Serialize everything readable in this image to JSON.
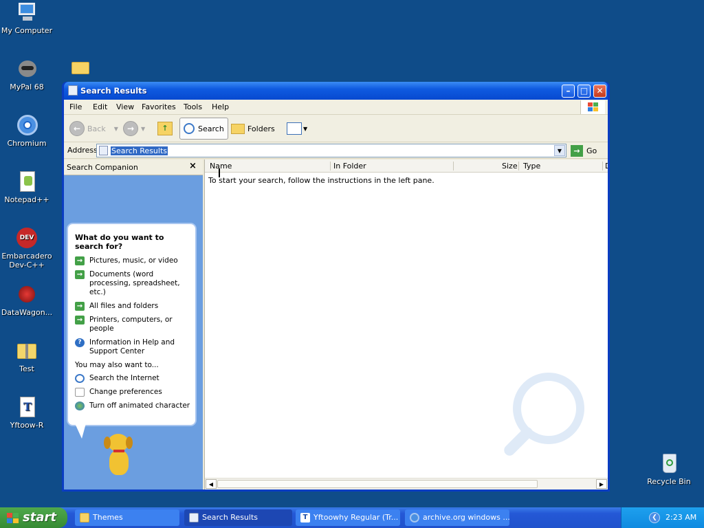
{
  "desktop": {
    "icons": [
      {
        "label": "My Computer"
      },
      {
        "label": "MyPal 68"
      },
      {
        "label": "Chromium"
      },
      {
        "label": "Notepad++"
      },
      {
        "label": "Embarcadero Dev-C++"
      },
      {
        "label": "DataWagon..."
      },
      {
        "label": "Test"
      },
      {
        "label": "Yftoow-R"
      },
      {
        "label": "Recycle Bin"
      }
    ]
  },
  "window": {
    "title": "Search Results",
    "menu": [
      "File",
      "Edit",
      "View",
      "Favorites",
      "Tools",
      "Help"
    ],
    "toolbar": {
      "back_label": "Back",
      "search_label": "Search",
      "folders_label": "Folders"
    },
    "address": {
      "label": "Address",
      "value": "Search Results",
      "go_label": "Go"
    },
    "companion": {
      "title": "Search Companion",
      "question": "What do you want to search for?",
      "options": [
        "Pictures, music, or video",
        "Documents (word processing, spreadsheet, etc.)",
        "All files and folders",
        "Printers, computers, or people",
        "Information in Help and Support Center"
      ],
      "also_label": "You may also want to...",
      "also_options": [
        "Search the Internet",
        "Change preferences",
        "Turn off animated character"
      ]
    },
    "results": {
      "columns": [
        "Name",
        "In Folder",
        "Size",
        "Type",
        "D"
      ],
      "message": "To start your search, follow the instructions in the left pane."
    }
  },
  "taskbar": {
    "start_label": "start",
    "tasks": [
      "Themes",
      "Search Results",
      "Yftoowhy Regular (Tr...",
      "archive.org windows ..."
    ],
    "clock": "2:23 AM"
  }
}
